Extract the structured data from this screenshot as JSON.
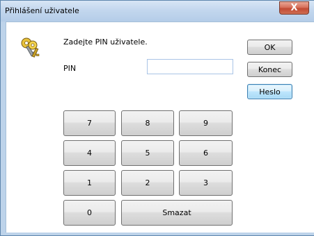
{
  "window": {
    "title": "Přihlášení uživatele",
    "close_label": "X"
  },
  "dialog": {
    "prompt": "Zadejte PIN uživatele.",
    "pin_label": "PIN",
    "pin_value": ""
  },
  "buttons": {
    "ok": "OK",
    "konec": "Konec",
    "heslo": "Heslo"
  },
  "keypad": {
    "k7": "7",
    "k8": "8",
    "k9": "9",
    "k4": "4",
    "k5": "5",
    "k6": "6",
    "k1": "1",
    "k2": "2",
    "k3": "3",
    "k0": "0",
    "clear": "Smazat"
  },
  "icons": {
    "dialog_icon": "keys-icon"
  }
}
